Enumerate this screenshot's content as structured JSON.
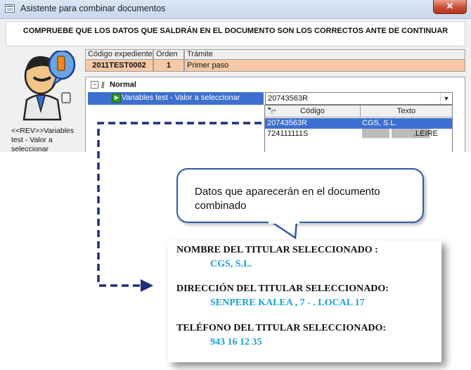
{
  "window": {
    "title": "Asistente para combinar documentos",
    "close_glyph": "✕"
  },
  "banner": {
    "text": "COMPRUEBE QUE LOS DATOS QUE SALDRÁN EN EL DOCUMENTO SON LOS CORRECTOS ANTE DE CONTINUAR"
  },
  "left_panel": {
    "icon": "user-wizard-icon",
    "label": "<<REV>>Variables test - Valor a seleccionar"
  },
  "record": {
    "headers": [
      "Código expediente",
      "Orden",
      "Trámite"
    ],
    "values": [
      "2011TEST0002",
      "1",
      "Primer paso"
    ]
  },
  "tree": {
    "expander": "−",
    "node_label": "Normal",
    "variable_label": "Variables test - Valor a seleccionar",
    "combo_value": "20743563R",
    "combo_arrow": "▼"
  },
  "dropdown": {
    "headers": [
      "Código",
      "Texto"
    ],
    "rows": [
      {
        "codigo": "20743563R",
        "texto": "CGS, S.L.",
        "selected": true
      },
      {
        "codigo": "724111111S",
        "texto": ",LEIRE",
        "selected": false
      }
    ]
  },
  "callout": {
    "text": "Datos que aparecerán en el documento combinado"
  },
  "document": {
    "fields": [
      {
        "label": "NOMBRE DEL TITULAR SELECCIONADO :",
        "value": "CGS, S.L."
      },
      {
        "label": "DIRECCIÓN DEL TITULAR SELECCIONADO:",
        "value": "SENPERE KALEA , 7 - .  LOCAL 17"
      },
      {
        "label": "TELÉFONO DEL TITULAR SELECCIONADO:",
        "value": "943 16 12 35"
      }
    ]
  },
  "colors": {
    "accent_blue": "#2f5aa8",
    "value_cyan": "#1ca0d8",
    "record_bg": "#f7c9a6",
    "selection": "#3d6fd0"
  }
}
